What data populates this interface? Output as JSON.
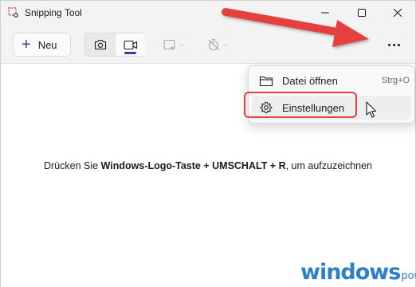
{
  "window": {
    "title": "Snipping Tool"
  },
  "toolbar": {
    "new_label": "Neu",
    "modes": [
      "camera-icon",
      "video-camera-icon"
    ],
    "selected_mode": "video",
    "shape_dropdown_icon": "rectangle-select-icon",
    "timer_dropdown_icon": "timer-off-icon",
    "more_icon": "more-dots-icon"
  },
  "menu": {
    "items": [
      {
        "label": "Datei öffnen",
        "shortcut": "Strg+O",
        "icon": "folder-icon"
      },
      {
        "label": "Einstellungen",
        "shortcut": "",
        "icon": "gear-icon"
      }
    ]
  },
  "content": {
    "hint_prefix": "Drücken Sie ",
    "hint_bold": "Windows-Logo-Taste + UMSCHALT + R",
    "hint_suffix": ", um aufzuzeichnen"
  },
  "watermark": {
    "main": "windows",
    "sub": "power."
  },
  "colors": {
    "accent": "#5b2aa7",
    "annotation_red": "#e04040",
    "watermark_blue": "#2f7fc8"
  }
}
